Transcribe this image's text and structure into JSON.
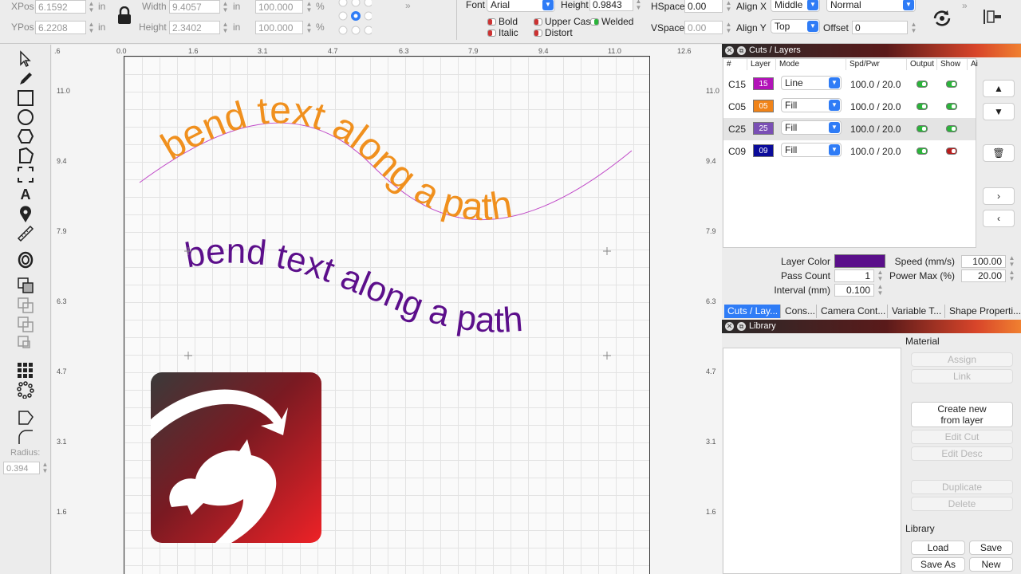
{
  "toolbar": {
    "xpos_label": "XPos",
    "xpos_value": "6.1592",
    "xpos_unit": "in",
    "ypos_label": "YPos",
    "ypos_value": "6.2208",
    "ypos_unit": "in",
    "width_label": "Width",
    "width_value": "9.4057",
    "width_unit": "in",
    "height_label": "Height",
    "height_value": "2.3402",
    "height_unit": "in",
    "scale_w": "100.000",
    "scale_h": "100.000",
    "pct": "%",
    "font_label": "Font",
    "font_value": "Arial",
    "text_height_label": "Height",
    "text_height_value": "0.9843",
    "bold": "Bold",
    "italic": "Italic",
    "upper_case": "Upper Cas",
    "distort": "Distort",
    "welded": "Welded",
    "hspace_label": "HSpace",
    "hspace_value": "0.00",
    "vspace_label": "VSpace",
    "vspace_value": "0.00",
    "alignx_label": "Align X",
    "alignx_value": "Middle",
    "aligny_label": "Align Y",
    "aligny_value": "Top",
    "mode_value": "Normal",
    "offset_label": "Offset",
    "offset_value": "0"
  },
  "left": {
    "radius_label": "Radius:",
    "radius_value": "0.394"
  },
  "rulers": {
    "x": [
      "0.0",
      "1.6",
      "3.1",
      "4.7",
      "6.3",
      "7.9",
      "9.4",
      "11.0",
      "12.6"
    ],
    "x_neg": ".6",
    "y": [
      "11.0",
      "9.4",
      "7.9",
      "6.3",
      "4.7",
      "3.1",
      "1.6"
    ]
  },
  "canvas": {
    "text_orange": "bend text along a path",
    "text_purple": "bend text along a path",
    "orange_color": "#f0901e",
    "purple_color": "#5c0f8b"
  },
  "cuts_layers": {
    "title": "Cuts / Layers",
    "headers": [
      "#",
      "Layer",
      "Mode",
      "Spd/Pwr",
      "Output",
      "Show",
      "Ai"
    ],
    "rows": [
      {
        "name": "C15",
        "layer": "15",
        "color": "#b213b8",
        "mode": "Line",
        "spd": "100.0 / 20.0",
        "output": true,
        "show": true
      },
      {
        "name": "C05",
        "layer": "05",
        "color": "#f08318",
        "mode": "Fill",
        "spd": "100.0 / 20.0",
        "output": true,
        "show": true
      },
      {
        "name": "C25",
        "layer": "25",
        "color": "#7a4fb5",
        "mode": "Fill",
        "spd": "100.0 / 20.0",
        "output": true,
        "show": true
      },
      {
        "name": "C09",
        "layer": "09",
        "color": "#0b0b9a",
        "mode": "Fill",
        "spd": "100.0 / 20.0",
        "output": true,
        "show": false
      }
    ],
    "layer_color_label": "Layer Color",
    "layer_color": "#5a0f8a",
    "speed_label": "Speed (mm/s)",
    "speed_value": "100.00",
    "pass_label": "Pass Count",
    "pass_value": "1",
    "power_label": "Power Max (%)",
    "power_value": "20.00",
    "interval_label": "Interval (mm)",
    "interval_value": "0.100"
  },
  "tabs": [
    "Cuts / Lay...",
    "Cons...",
    "Camera Cont...",
    "Variable T...",
    "Shape Properti..."
  ],
  "library": {
    "title": "Library",
    "material_label": "Material",
    "assign": "Assign",
    "link": "Link",
    "create_new": "Create new\nfrom layer",
    "edit_cut": "Edit Cut",
    "edit_desc": "Edit Desc",
    "duplicate": "Duplicate",
    "delete": "Delete",
    "library_label": "Library",
    "load": "Load",
    "save": "Save",
    "save_as": "Save As",
    "new": "New"
  }
}
